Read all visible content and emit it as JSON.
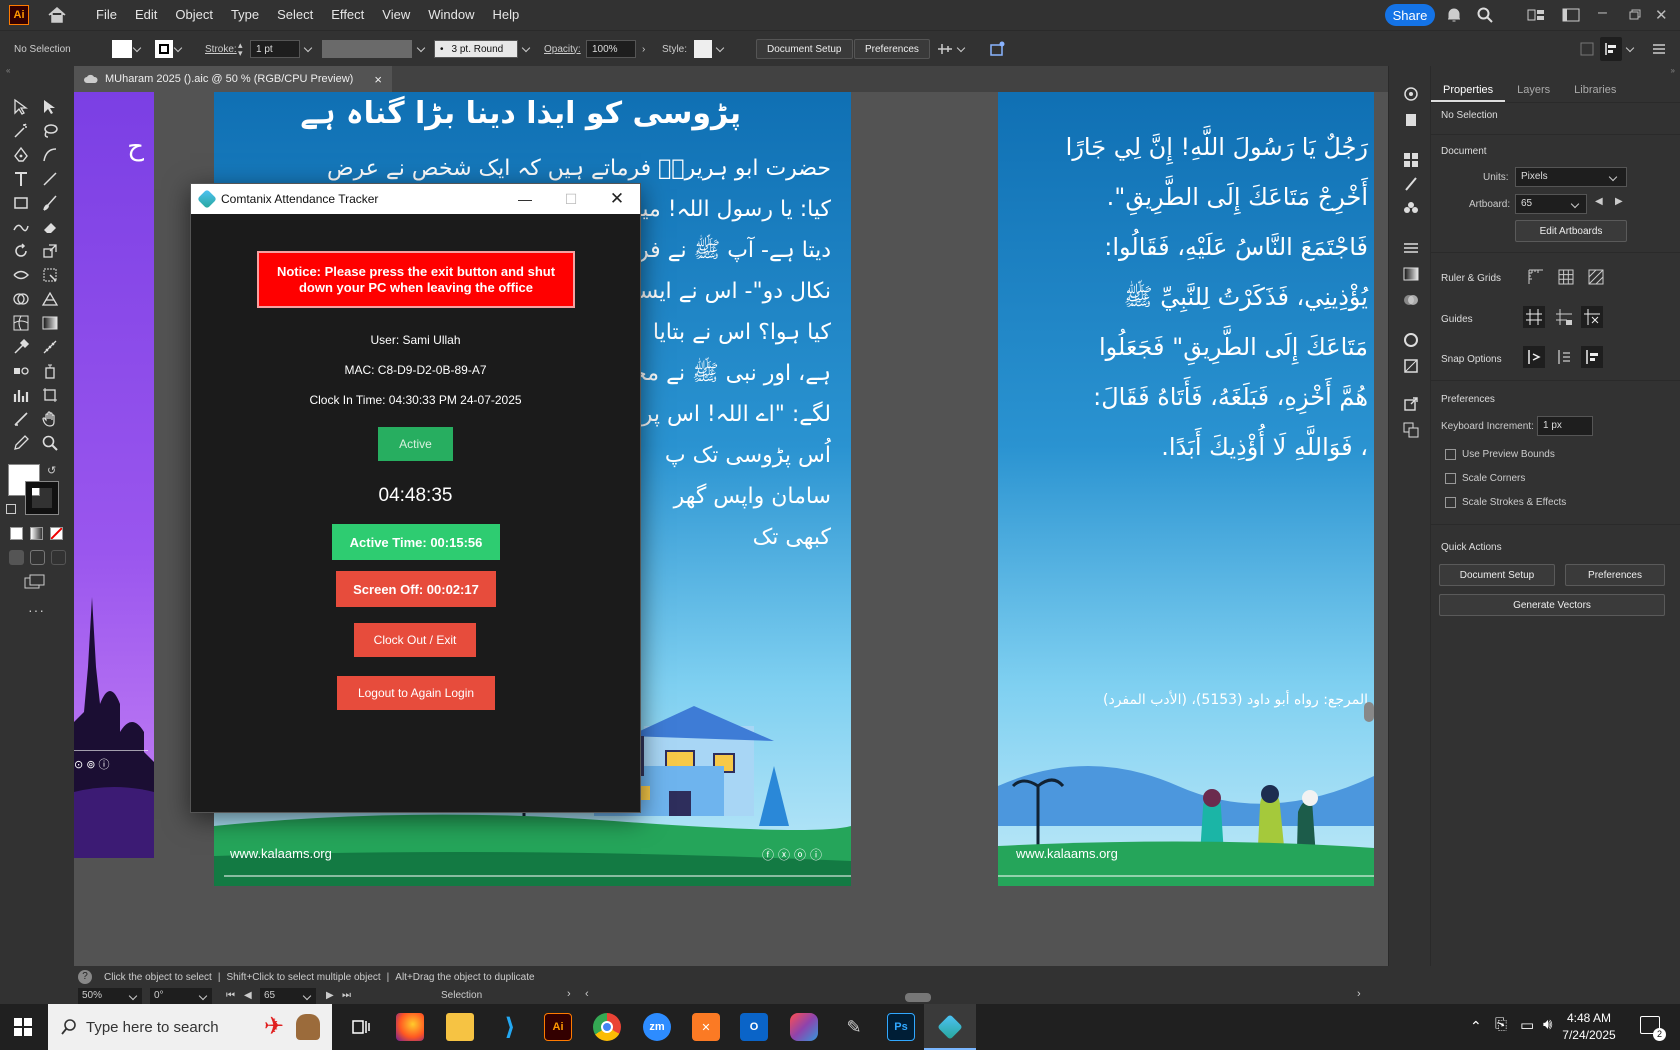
{
  "menu": [
    "File",
    "Edit",
    "Object",
    "Type",
    "Select",
    "Effect",
    "View",
    "Window",
    "Help"
  ],
  "app_logo": "Ai",
  "share_label": "Share",
  "control": {
    "selection": "No Selection",
    "stroke_label": "Stroke:",
    "stroke_value": "1 pt",
    "brush_value": "3 pt. Round",
    "opacity_label": "Opacity:",
    "opacity_value": "100%",
    "style_label": "Style:",
    "document_setup": "Document Setup",
    "preferences": "Preferences"
  },
  "doc_tab": {
    "title": "MUharam 2025 ().aic @ 50 % (RGB/CPU Preview)",
    "close": "×"
  },
  "panel": {
    "tabs": [
      "Properties",
      "Layers",
      "Libraries"
    ],
    "no_selection": "No Selection",
    "document_heading": "Document",
    "units_label": "Units:",
    "units_value": "Pixels",
    "artboard_label": "Artboard:",
    "artboard_value": "65",
    "edit_artboards": "Edit Artboards",
    "ruler_grids": "Ruler & Grids",
    "guides": "Guides",
    "snap_options": "Snap Options",
    "preferences_heading": "Preferences",
    "keyboard_increment_label": "Keyboard Increment:",
    "keyboard_increment_value": "1 px",
    "checkboxes": [
      "Use Preview Bounds",
      "Scale Corners",
      "Scale Strokes & Effects"
    ],
    "quick_actions": "Quick Actions",
    "document_setup": "Document Setup",
    "preferences": "Preferences",
    "generate_vectors": "Generate Vectors"
  },
  "status": {
    "hint_1": "Click the object to select",
    "hint_2": "Shift+Click to select multiple object",
    "hint_3": "Alt+Drag the object to duplicate",
    "sep": "|",
    "zoom": "50%",
    "rotation": "0°",
    "artboard": "65",
    "tool": "Selection"
  },
  "artboards": {
    "left": {
      "title": "پڑوسی کو ایذا دینا بڑا گناہ ہے",
      "lines": [
        "حضرت ابو ہریرہؓ فرماتے ہیں کہ ایک شخص نے عرض",
        "کیا: یا رسول اللہ! میرا",
        "دیتا ہے- آپ ﷺ نے فر",
        "نکال دو\"- اس نے ایسا",
        "کیا ہوا؟ اس نے بتایا",
        "ہے، اور نبی ﷺ نے مجھ",
        "لگے: \"اے اللہ! اس پر",
        "اُس پڑوسی تک پ",
        "سامان واپس گھر",
        "کبھی تک"
      ],
      "website": "www.kalaams.org"
    },
    "right": {
      "lines": [
        "رَجُلٌ يَا رَسُولَ اللَّهِ! إِنَّ لِي جَارًا",
        "أَخْرِجْ مَتَاعَكَ إِلَى الطَّرِيقِ\".",
        "فَاجْتَمَعَ النَّاسُ عَلَيْهِ، فَقَالُوا:",
        "يُؤْذِينِي، فَذَكَرْتُ لِلنَّبِيِّ ﷺ",
        "مَتَاعَكَ إِلَى الطَّرِيقِ\" فَجَعَلُوا",
        "هُمَّ أَخْزِهِ، فَبَلَغَهُ، فَأَتَاهُ فَقَالَ:",
        "، فَوَاللَّهِ لَا أُؤْذِيكَ أَبَدًا."
      ],
      "reference": "المرجع: رواه أبو داود (5153)، (الأدب المفرد)",
      "website": "www.kalaams.org"
    }
  },
  "tracker": {
    "title": "Comtanix Attendance Tracker",
    "notice": "Notice: Please press the exit button and shut down your PC when leaving the office",
    "user": "User: Sami Ullah",
    "mac": "MAC: C8-D9-D2-0B-89-A7",
    "clock_in": "Clock In Time: 04:30:33 PM 24-07-2025",
    "status": "Active",
    "timer": "04:48:35",
    "active_time": "Active Time: 00:15:56",
    "screen_off": "Screen Off: 00:02:17",
    "clock_out": "Clock Out / Exit",
    "logout": "Logout to Again Login"
  },
  "taskbar": {
    "search_placeholder": "Type here to search",
    "apps": [
      "Ai",
      "zm",
      "Ps"
    ],
    "time": "4:48 AM",
    "date": "7/24/2025",
    "notification_count": "2"
  },
  "colors": {
    "notice_red": "#ff0000",
    "active_green": "#2ecc71",
    "status_green": "#27ae60",
    "action_red": "#e74c3c",
    "share_blue": "#1473e6"
  }
}
